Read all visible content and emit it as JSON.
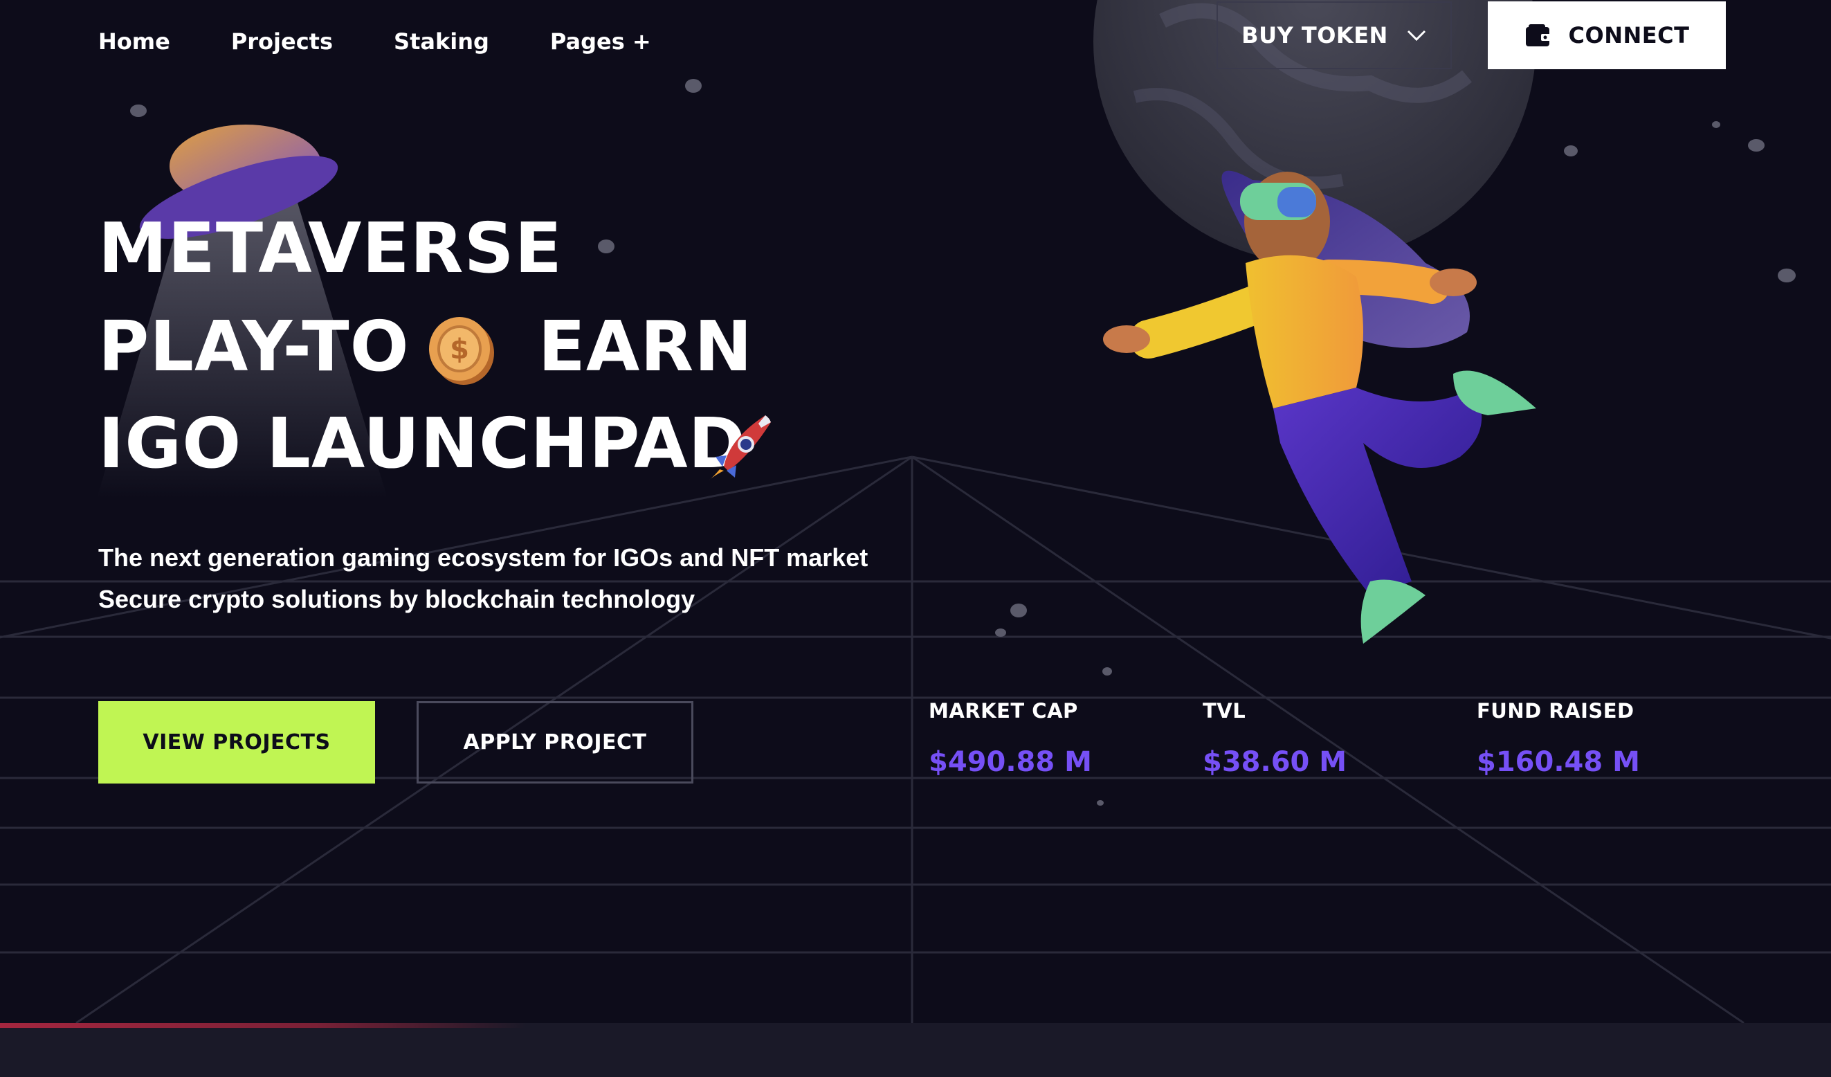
{
  "nav": {
    "home": "Home",
    "projects": "Projects",
    "staking": "Staking",
    "pages": "Pages +"
  },
  "header": {
    "buy_token": "BUY TOKEN",
    "connect": "CONNECT"
  },
  "hero": {
    "line1": "METAVERSE",
    "line2_a": "PLAY-TO",
    "line2_b": "EARN",
    "line3": "IGO LAUNCHPAD",
    "sub1": "The next generation gaming ecosystem for IGOs and NFT market",
    "sub2": "Secure crypto solutions by blockchain technology"
  },
  "actions": {
    "view_projects": "VIEW PROJECTS",
    "apply_project": "APPLY PROJECT"
  },
  "stats": [
    {
      "label": "MARKET CAP",
      "value": "$490.88 M"
    },
    {
      "label": "TVL",
      "value": "$38.60 M"
    },
    {
      "label": "FUND RAISED",
      "value": "$160.48 M"
    }
  ],
  "icons": {
    "buy_token_chevron": "chevron-down-icon",
    "connect_wallet": "wallet-icon",
    "coin": "coin-icon",
    "rocket": "rocket-icon"
  },
  "colors": {
    "background": "#0d0c1a",
    "accent_green": "#c0f553",
    "stat_value": "#7650f6",
    "connect_bg": "#ffffff"
  }
}
